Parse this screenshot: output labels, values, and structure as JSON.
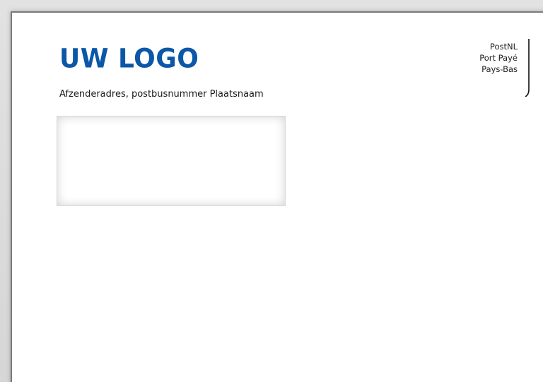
{
  "envelope": {
    "logo_text": "UW LOGO",
    "sender_address": "Afzenderadres, postbusnummer Plaatsnaam",
    "postage": {
      "line1": "PostNL",
      "line2": "Port Payé",
      "line3": "Pays-Bas"
    },
    "address_window": ""
  },
  "colors": {
    "logo": "#0b57a8",
    "paper": "#ffffff",
    "background": "#d9d9d9"
  }
}
